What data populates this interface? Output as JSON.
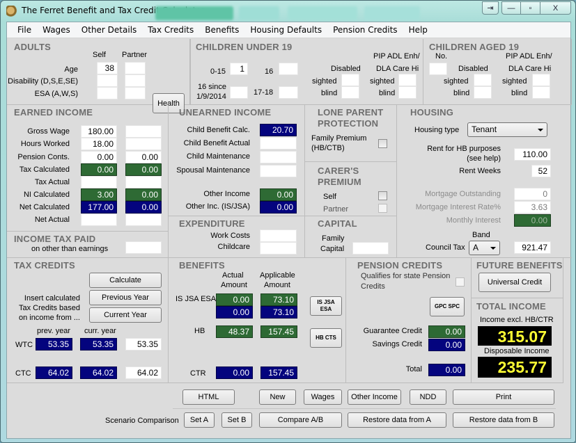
{
  "window": {
    "title": "The Ferret Benefit and Tax Credit Calculator",
    "controls": {
      "restore": "⇥",
      "minimize": "—",
      "maximize": "▫",
      "close": "X"
    }
  },
  "menu": [
    "File",
    "Wages",
    "Other Details",
    "Tax Credits",
    "Benefits",
    "Housing Defaults",
    "Pension Credits",
    "Help"
  ],
  "adults": {
    "title": "ADULTS",
    "col_self": "Self",
    "col_partner": "Partner",
    "rows": [
      {
        "label": "Age",
        "self": "38",
        "partner": ""
      },
      {
        "label": "Disability (D,S,E,SE)",
        "self": "",
        "partner": ""
      },
      {
        "label": "ESA (A,W,S)",
        "self": "",
        "partner": ""
      }
    ],
    "health_button": "Health"
  },
  "children_under_19": {
    "title": "CHILDREN UNDER 19",
    "age_0_15_label": "0-15",
    "age_0_15": "1",
    "age_16_label": "16",
    "age_16": "",
    "age_16_since_label_1": "16 since",
    "age_16_since_label_2": "1/9/2014",
    "age_16_since": "",
    "age_17_18_label": "17-18",
    "age_17_18": "",
    "disabled_label": "Disabled",
    "pip_label_1": "PIP ADL Enh/",
    "pip_label_2": "DLA Care Hi",
    "sighted_label": "sighted",
    "blind_label": "blind",
    "disabled_sighted": "",
    "disabled_blind": "",
    "pip_sighted": "",
    "pip_blind": ""
  },
  "children_aged_19": {
    "title": "CHILDREN AGED 19",
    "no_label": "No.",
    "no": "",
    "disabled_label": "Disabled",
    "pip_label_1": "PIP ADL Enh/",
    "pip_label_2": "DLA Care Hi",
    "sighted_label": "sighted",
    "blind_label": "blind",
    "disabled_sighted": "",
    "disabled_blind": "",
    "pip_sighted": "",
    "pip_blind": ""
  },
  "earned_income": {
    "title": "EARNED INCOME",
    "rows": [
      {
        "label": "Gross Wage",
        "self": "180.00",
        "partner": ""
      },
      {
        "label": "Hours Worked",
        "self": "18.00",
        "partner": ""
      },
      {
        "label": "Pension Conts.",
        "self": "0.00",
        "partner": "0.00"
      },
      {
        "label": "Tax Calculated",
        "self": "0.00",
        "partner": "0.00"
      },
      {
        "label": "Tax Actual",
        "self": "",
        "partner": ""
      },
      {
        "label": "NI Calculated",
        "self": "3.00",
        "partner": "0.00"
      },
      {
        "label": "Net Calculated",
        "self": "177.00",
        "partner": "0.00"
      },
      {
        "label": "Net Actual",
        "self": "",
        "partner": ""
      }
    ]
  },
  "income_tax_paid": {
    "title": "INCOME TAX PAID",
    "subtitle": "on other than earnings",
    "value": ""
  },
  "unearned_income": {
    "title": "UNEARNED INCOME",
    "child_benefit_calc_label": "Child Benefit Calc.",
    "child_benefit_calc": "20.70",
    "child_benefit_actual_label": "Child Benefit Actual",
    "child_benefit_actual": "",
    "child_maintenance_label": "Child Maintenance",
    "child_maintenance": "",
    "spousal_maintenance_label": "Spousal Maintenance",
    "spousal_maintenance": "",
    "other_income_label": "Other Income",
    "other_income": "0.00",
    "other_inc_isjsa_label": "Other Inc. (IS/JSA)",
    "other_inc_isjsa": "0.00"
  },
  "lone_parent": {
    "title_1": "LONE PARENT",
    "title_2": "PROTECTION",
    "family_premium_label_1": "Family Premium",
    "family_premium_label_2": "(HB/CTB)",
    "family_premium_checked": false
  },
  "carers_premium": {
    "title_1": "CARER'S",
    "title_2": "PREMIUM",
    "self_label": "Self",
    "self_checked": false,
    "partner_label": "Partner",
    "partner_checked": false
  },
  "expenditure": {
    "title": "EXPENDITURE",
    "work_costs_label": "Work Costs",
    "work_costs": "",
    "childcare_label": "Childcare",
    "childcare": ""
  },
  "capital": {
    "title": "CAPITAL",
    "family_capital_label_1": "Family",
    "family_capital_label_2": "Capital",
    "family_capital": ""
  },
  "housing": {
    "title": "HOUSING",
    "housing_type_label": "Housing type",
    "housing_type": "Tenant",
    "rent_label_1": "Rent for HB purposes",
    "rent_label_2": "(see help)",
    "rent": "110.00",
    "rent_weeks_label": "Rent Weeks",
    "rent_weeks": "52",
    "mortgage_outstanding_label": "Mortgage Outstanding",
    "mortgage_outstanding": "0",
    "mortgage_rate_label": "Mortgage Interest Rate%",
    "mortgage_rate": "3.63",
    "monthly_interest_label": "Monthly Interest",
    "monthly_interest": "0.00",
    "band_label": "Band",
    "council_tax_label": "Council Tax",
    "council_tax_band": "A",
    "council_tax": "921.47"
  },
  "tax_credits": {
    "title": "TAX CREDITS",
    "calculate_button": "Calculate",
    "previous_year_button": "Previous Year",
    "current_year_button": "Current Year",
    "insert_text_1": "Insert calculated",
    "insert_text_2": "Tax Credits based",
    "insert_text_3": "on income from ...",
    "prev_year_label": "prev. year",
    "curr_year_label": "curr. year",
    "wtc_label": "WTC",
    "wtc_prev": "53.35",
    "wtc_curr": "53.35",
    "wtc_value": "53.35",
    "ctc_label": "CTC",
    "ctc_prev": "64.02",
    "ctc_curr": "64.02",
    "ctc_value": "64.02"
  },
  "benefits": {
    "title": "BENEFITS",
    "actual_label_1": "Actual",
    "actual_label_2": "Amount",
    "applicable_label_1": "Applicable",
    "applicable_label_2": "Amount",
    "is_jsa_esa_label": "IS JSA ESA",
    "is_jsa_esa_actual_1": "0.00",
    "is_jsa_esa_applicable_1": "73.10",
    "is_jsa_esa_actual_2": "0.00",
    "is_jsa_esa_applicable_2": "73.10",
    "is_jsa_esa_button_1": "IS JSA",
    "is_jsa_esa_button_2": "ESA",
    "hb_label": "HB",
    "hb_actual": "48.37",
    "hb_applicable": "157.45",
    "hb_cts_button": "HB CTS",
    "ctr_label": "CTR",
    "ctr_actual": "0.00",
    "ctr_applicable": "157.45"
  },
  "pension_credits": {
    "title": "PENSION CREDITS",
    "qualifies_label_1": "Qualifies for state Pension",
    "qualifies_label_2": "Credits",
    "qualifies_checked": false,
    "gpc_spc_button": "GPC SPC",
    "guarantee_label": "Guarantee Credit",
    "guarantee": "0.00",
    "savings_label": "Savings Credit",
    "savings": "0.00",
    "total_label": "Total",
    "total": "0.00"
  },
  "future_benefits": {
    "title": "FUTURE BENEFITS",
    "universal_credit_button": "Universal Credit"
  },
  "total_income": {
    "title": "TOTAL INCOME",
    "income_excl_label": "Income excl. HB/CTR",
    "income_excl": "315.07",
    "disposable_label": "Disposable Income",
    "disposable": "235.77"
  },
  "bottom": {
    "html_button": "HTML",
    "new_button": "New",
    "wages_button": "Wages",
    "other_income_button": "Other Income",
    "ndd_button": "NDD",
    "print_button": "Print",
    "scenario_label": "Scenario Comparison",
    "set_a_button": "Set A",
    "set_b_button": "Set B",
    "compare_button": "Compare A/B",
    "restore_a_button": "Restore data from A",
    "restore_b_button": "Restore data from B"
  },
  "colors": {
    "calc_green": "#2e6a34",
    "calc_blue": "#04047e",
    "total_yellow": "#ffff33",
    "panel_bg": "#dcdcdc",
    "header_grey": "#6e6e6e"
  }
}
